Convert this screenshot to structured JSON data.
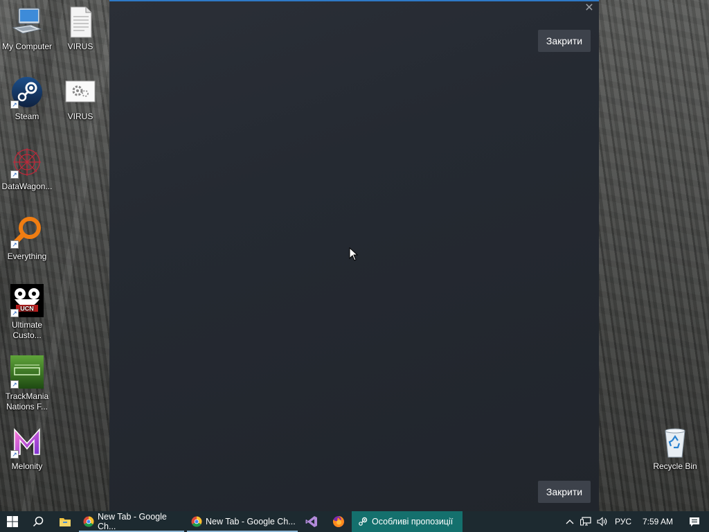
{
  "desktop": {
    "icons": [
      {
        "label": "My Computer"
      },
      {
        "label": "VIRUS"
      },
      {
        "label": "Steam"
      },
      {
        "label": "VIRUS"
      },
      {
        "label": "DataWagon..."
      },
      {
        "label": "Everything"
      },
      {
        "label": "Ultimate Custo..."
      },
      {
        "label": "TrackMania Nations F..."
      },
      {
        "label": "Melonity"
      },
      {
        "label": "Recycle Bin"
      }
    ]
  },
  "steam_window": {
    "close_top_label": "Закрити",
    "close_bottom_label": "Закрити",
    "border_color": "#2e79c7"
  },
  "taskbar": {
    "apps": [
      {
        "label": "New Tab - Google Ch...",
        "icon": "chrome-icon"
      },
      {
        "label": "New Tab - Google Ch...",
        "icon": "chrome-icon"
      },
      {
        "label": "",
        "icon": "visual-studio-icon"
      },
      {
        "label": "",
        "icon": "firefox-icon"
      },
      {
        "label": "Особливі пропозиції",
        "icon": "steam-icon"
      }
    ],
    "tray": {
      "language": "РУС",
      "time": "7:59 AM"
    },
    "active_color": "#14706d"
  }
}
